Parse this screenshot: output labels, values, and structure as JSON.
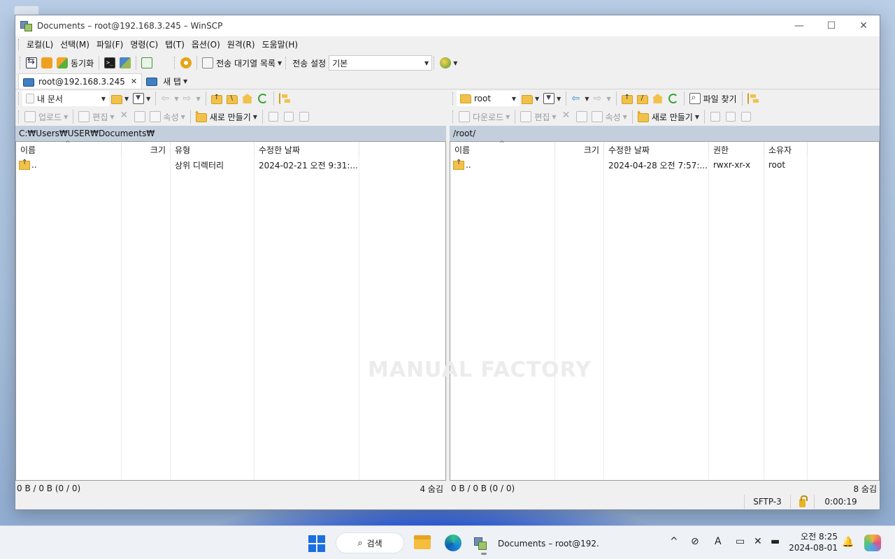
{
  "window": {
    "title": "Documents – root@192.168.3.245 – WinSCP"
  },
  "menu": [
    "로컬(L)",
    "선택(M)",
    "파일(F)",
    "명령(C)",
    "탭(T)",
    "옵션(O)",
    "원격(R)",
    "도움말(H)"
  ],
  "toolbar": {
    "sync_label": "동기화",
    "queue_label": "전송 대기열 목록",
    "transfer_settings_label": "전송 설정",
    "transfer_preset": "기본"
  },
  "tabs": {
    "session": "root@192.168.3.245",
    "new_tab": "새 탭"
  },
  "left": {
    "location": "내 문서",
    "upload_label": "업로드",
    "edit_label": "편집",
    "properties_label": "속성",
    "new_label": "새로 만들기",
    "path": "C:₩Users₩USER₩Documents₩",
    "columns": [
      "이름",
      "크기",
      "유형",
      "수정한 날짜"
    ],
    "rows": [
      {
        "name": "..",
        "size": "",
        "type": "상위 디렉터리",
        "modified": "2024-02-21 오전 9:31:..."
      }
    ],
    "status_left": "0 B / 0 B (0 / 0)",
    "status_right": "4 숨김"
  },
  "right": {
    "location": "root",
    "find_label": "파일 찾기",
    "download_label": "다운로드",
    "edit_label": "편집",
    "properties_label": "속성",
    "new_label": "새로 만들기",
    "path": "/root/",
    "columns": [
      "이름",
      "크기",
      "수정한 날짜",
      "권한",
      "소유자"
    ],
    "rows": [
      {
        "name": "..",
        "size": "",
        "modified": "2024-04-28 오전 7:57:...",
        "rights": "rwxr-xr-x",
        "owner": "root"
      }
    ],
    "status_left": "0 B / 0 B (0 / 0)",
    "status_right": "8 숨김"
  },
  "statusbar": {
    "protocol": "SFTP-3",
    "elapsed": "0:00:19"
  },
  "watermark": "MANUAL FACTORY",
  "taskbar": {
    "search_label": "검색",
    "app_label": "Documents – root@192.",
    "time": "오전 8:25",
    "date": "2024-08-01"
  }
}
